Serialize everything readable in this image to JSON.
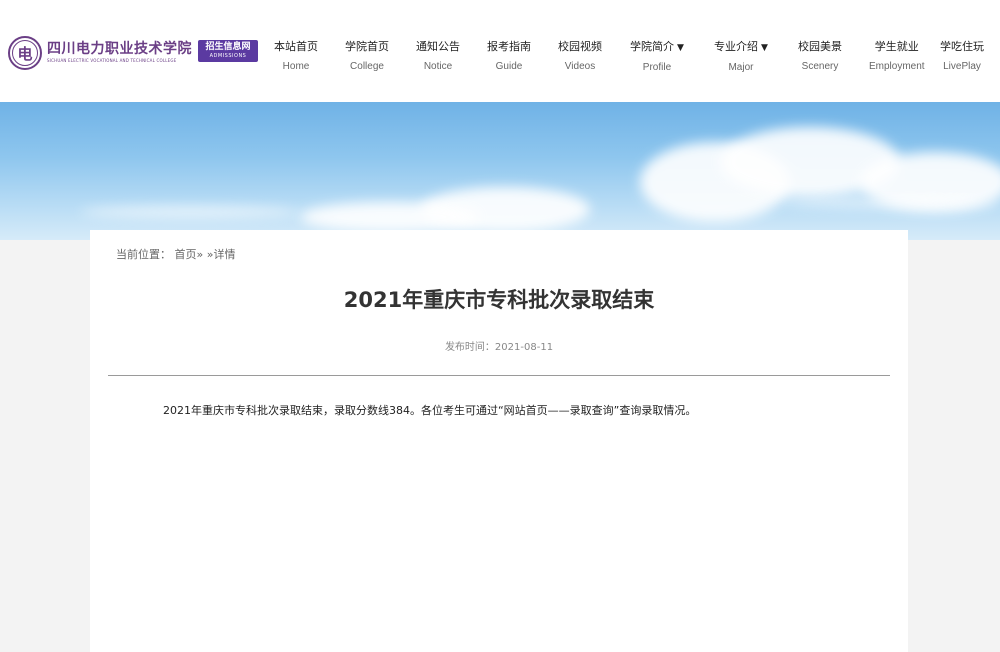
{
  "logo": {
    "seal_char": "电",
    "name_cn": "四川电力职业技术学院",
    "name_en": "SICHUAN ELECTRIC VOCATIONAL AND TECHNICAL COLLEGE",
    "badge_cn": "招生信息网",
    "badge_en": "ADMISSIONS",
    "brand_color": "#6b3f86",
    "badge_color": "#5b3aa1"
  },
  "nav": {
    "items": [
      {
        "cn": "本站首页",
        "en": "Home"
      },
      {
        "cn": "学院首页",
        "en": "College"
      },
      {
        "cn": "通知公告",
        "en": "Notice"
      },
      {
        "cn": "报考指南",
        "en": "Guide"
      },
      {
        "cn": "校园视频",
        "en": "Videos"
      },
      {
        "cn": "学院简介",
        "en": "Profile",
        "dropdown": true
      },
      {
        "cn": "专业介绍",
        "en": "Major",
        "dropdown": true
      },
      {
        "cn": "校园美景",
        "en": "Scenery"
      },
      {
        "cn": "学生就业",
        "en": "Employment"
      },
      {
        "cn": "学吃住玩",
        "en": "LivePlay"
      }
    ],
    "caret": "▼"
  },
  "breadcrumb": {
    "prefix": "当前位置：",
    "home": "首页»",
    "current": "»详情"
  },
  "article": {
    "title": "2021年重庆市专科批次录取结束",
    "published": "发布时间：2021-08-11",
    "body": "2021年重庆市专科批次录取结束，录取分数线384。各位考生可通过“网站首页——录取查询”查询录取情况。"
  }
}
